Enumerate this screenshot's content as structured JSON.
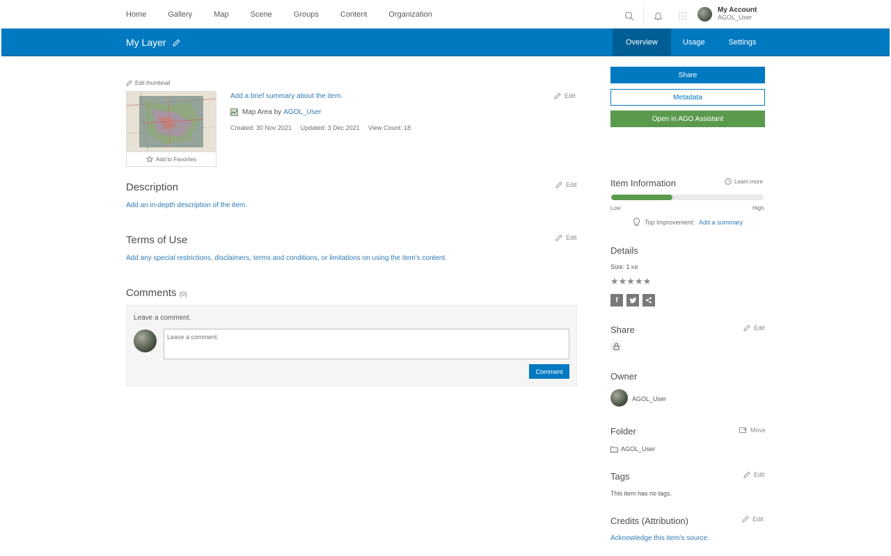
{
  "nav": {
    "items": [
      "Home",
      "Gallery",
      "Map",
      "Scene",
      "Groups",
      "Content",
      "Organization"
    ],
    "account_name": "My Account",
    "account_user": "AGOL_User"
  },
  "banner": {
    "title": "My Layer",
    "tabs": [
      "Overview",
      "Usage",
      "Settings"
    ],
    "active_tab": "Overview",
    "color": "#0079c1"
  },
  "item": {
    "edit_thumbnail": "Edit thumbnail",
    "add_favorites": "Add to Favorites",
    "summary": "Add a brief summary about the item.",
    "type_prefix": "Map Area by",
    "owner_link": "AGOL_User",
    "created": "Created: 30 Nov 2021",
    "updated": "Updated: 3 Dec 2021",
    "view_count": "View Count: 18",
    "edit": "Edit"
  },
  "description": {
    "heading": "Description",
    "link": "Add an in-depth description of the item.",
    "edit": "Edit"
  },
  "terms": {
    "heading": "Terms of Use",
    "link": "Add any special restrictions, disclaimers, terms and conditions, or limitations on using the item's content.",
    "edit": "Edit"
  },
  "comments": {
    "heading": "Comments",
    "count": "(0)",
    "leave_label": "Leave a comment.",
    "placeholder": "Leave a comment.",
    "button": "Comment"
  },
  "side": {
    "share_button": "Share",
    "metadata_button": "Metadata",
    "ago_button": "Open in AGO Assistant",
    "item_info": "Item Information",
    "learn_more": "Learn more",
    "info_progress": 0.4,
    "low": "Low",
    "high": "High",
    "top_improvement": "Top Improvement:",
    "add_summary": "Add a summary",
    "details": "Details",
    "size_label": "Size: 1",
    "size_unit": "KB",
    "rating_stars": "★★★★★",
    "share_heading": "Share",
    "share_edit": "Edit",
    "owner_heading": "Owner",
    "owner_name": "AGOL_User",
    "folder_heading": "Folder",
    "folder_move": "Move",
    "folder_name": "AGOL_User",
    "tags_heading": "Tags",
    "tags_edit": "Edit",
    "tags_text": "This item has no tags.",
    "credits_heading": "Credits (Attribution)",
    "credits_edit": "Edit",
    "credits_link": "Acknowledge this item's source."
  },
  "colors": {
    "accent": "#0079c1",
    "assistant_green": "#5a9a4d",
    "link": "#2e7ab3"
  }
}
